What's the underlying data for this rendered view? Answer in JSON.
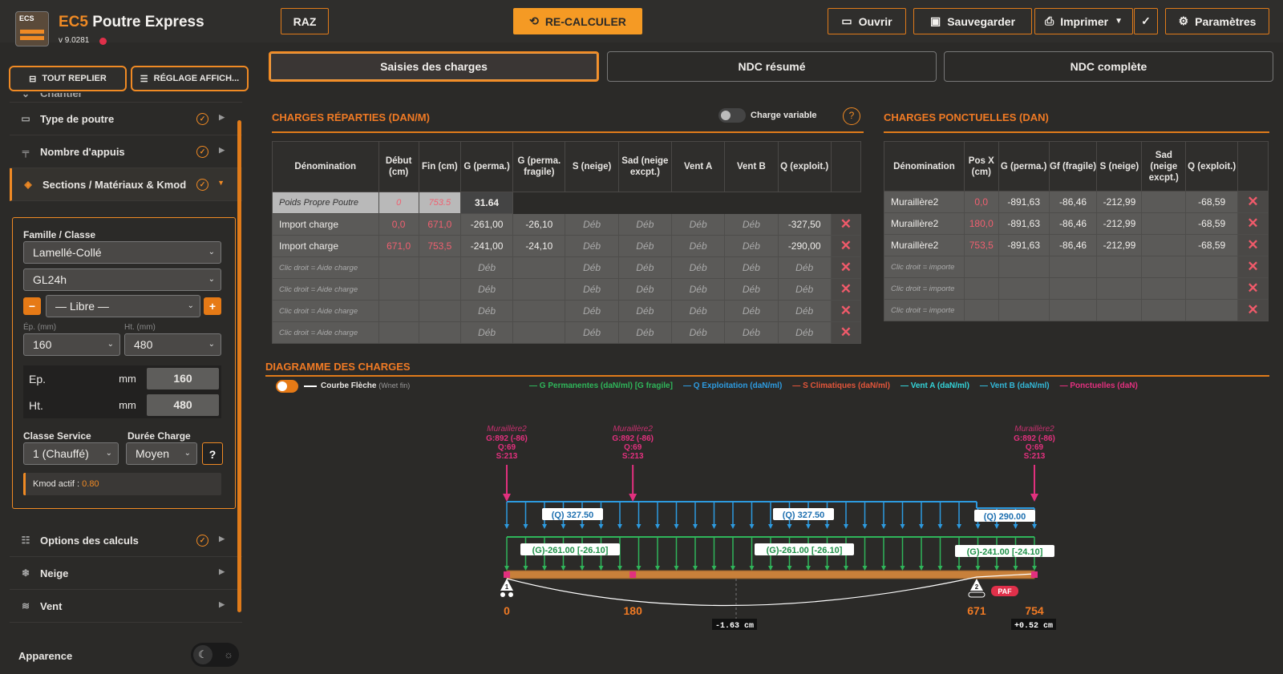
{
  "app": {
    "logo_text": "ECS",
    "title_brand": "EC5",
    "title": "Poutre Express",
    "version": "v 9.0281"
  },
  "topbar": {
    "raz": "RAZ",
    "recalc": "RE-CALCULER",
    "open": "Ouvrir",
    "save": "Sauvegarder",
    "print": "Imprimer",
    "settings": "Paramètres"
  },
  "sidebar": {
    "collapse_all": "TOUT REPLIER",
    "display_settings": "RÉGLAGE AFFICH...",
    "partial_item": "Chantier",
    "items": [
      {
        "label": "Type de poutre",
        "icon": "beam-icon"
      },
      {
        "label": "Nombre d'appuis",
        "icon": "supports-icon"
      },
      {
        "label": "Sections / Matériaux & Kmod",
        "icon": "layers-icon"
      }
    ],
    "panel": {
      "family_label": "Famille / Classe",
      "family": "Lamellé-Collé",
      "class": "GL24h",
      "free": "— Libre —",
      "ep_hint": "Ép. (mm)",
      "ht_hint": "Ht. (mm)",
      "ep_sel": "160",
      "ht_sel": "480",
      "ep_label": "Ep.",
      "ht_label": "Ht.",
      "unit": "mm",
      "ep_val": "160",
      "ht_val": "480",
      "service_label": "Classe Service",
      "duration_label": "Durée Charge",
      "service": "1 (Chauffé)",
      "duration": "Moyen",
      "help": "?",
      "kmod_label": "Kmod actif :",
      "kmod_val": "0.80"
    },
    "items2": [
      {
        "label": "Options des calculs",
        "icon": "sliders-icon"
      },
      {
        "label": "Neige",
        "icon": "snow-icon"
      },
      {
        "label": "Vent",
        "icon": "wind-icon"
      }
    ],
    "appearance": "Apparence"
  },
  "tabs": [
    "Saisies des charges",
    "NDC résumé",
    "NDC complète"
  ],
  "distributed": {
    "title": "CHARGES RÉPARTIES (DAN/M)",
    "variable": "Charge variable",
    "help": "?",
    "headers": [
      "Dénomination",
      "Début (cm)",
      "Fin (cm)",
      "G (perma.)",
      "G (perma. fragile)",
      "S (neige)",
      "Sad (neige excpt.)",
      "Vent A",
      "Vent B",
      "Q (exploit.)"
    ],
    "self_weight": {
      "name": "Poids Propre Poutre",
      "start": "0",
      "end": "753.5",
      "g": "31.64"
    },
    "rows": [
      [
        "Import charge",
        "0,0",
        "671,0",
        "-261,00",
        "-26,10",
        "Déb",
        "Déb",
        "Déb",
        "Déb",
        "-327,50"
      ],
      [
        "Import charge",
        "671,0",
        "753,5",
        "-241,00",
        "-24,10",
        "Déb",
        "Déb",
        "Déb",
        "Déb",
        "-290,00"
      ],
      [
        "Clic droit = Aide charge",
        "",
        "",
        "Déb",
        "",
        "Déb",
        "Déb",
        "Déb",
        "Déb",
        "Déb"
      ],
      [
        "Clic droit = Aide charge",
        "",
        "",
        "Déb",
        "",
        "Déb",
        "Déb",
        "Déb",
        "Déb",
        "Déb"
      ],
      [
        "Clic droit = Aide charge",
        "",
        "",
        "Déb",
        "",
        "Déb",
        "Déb",
        "Déb",
        "Déb",
        "Déb"
      ],
      [
        "Clic droit = Aide charge",
        "",
        "",
        "Déb",
        "",
        "Déb",
        "Déb",
        "Déb",
        "Déb",
        "Déb"
      ]
    ],
    "del": "✕"
  },
  "point": {
    "title": "CHARGES PONCTUELLES (DAN)",
    "headers": [
      "Dénomination",
      "Pos X (cm)",
      "G (perma.)",
      "Gf (fragile)",
      "S (neige)",
      "Sad (neige excpt.)",
      "Q (exploit.)"
    ],
    "rows": [
      [
        "Muraillère2",
        "0,0",
        "-891,63",
        "-86,46",
        "-212,99",
        "",
        "-68,59"
      ],
      [
        "Muraillère2",
        "180,0",
        "-891,63",
        "-86,46",
        "-212,99",
        "",
        "-68,59"
      ],
      [
        "Muraillère2",
        "753,5",
        "-891,63",
        "-86,46",
        "-212,99",
        "",
        "-68,59"
      ],
      [
        "Clic droit = importe",
        "",
        "",
        "",
        "",
        "",
        ""
      ],
      [
        "Clic droit = importe",
        "",
        "",
        "",
        "",
        "",
        ""
      ],
      [
        "Clic droit = importe",
        "",
        "",
        "",
        "",
        "",
        ""
      ]
    ]
  },
  "diagram": {
    "title": "DIAGRAMME DES CHARGES",
    "curve": "Courbe Flèche",
    "curve_sub": "(Wnet fin)",
    "legend": [
      {
        "label": "G Permanentes (daN/ml) [G fragile]",
        "color": "#2fb55a"
      },
      {
        "label": "Q Exploitation (daN/ml)",
        "color": "#2d9be0"
      },
      {
        "label": "S Climatiques (daN/ml)",
        "color": "#e2553a"
      },
      {
        "label": "Vent A (daN/ml)",
        "color": "#33d3d8"
      },
      {
        "label": "Vent B (daN/ml)",
        "color": "#33b8d8"
      },
      {
        "label": "Ponctuelles (daN)",
        "color": "#e2307e"
      }
    ],
    "point_labels": [
      {
        "pos": 0,
        "name": "Muraillère2",
        "g": "G:892 (-86)",
        "q": "Q:69",
        "s": "S:213"
      },
      {
        "pos": 180,
        "name": "Muraillère2",
        "g": "G:892 (-86)",
        "q": "Q:69",
        "s": "S:213"
      },
      {
        "pos": 753.5,
        "name": "Muraillère2",
        "g": "G:892 (-86)",
        "q": "Q:69",
        "s": "S:213"
      }
    ],
    "q_labels": [
      "(Q) 327.50",
      "(Q) 327.50",
      "(Q) 290.00"
    ],
    "g_labels": [
      "(G)-261.00 [-26.10]",
      "(G)-261.00 [-26.10]",
      "(G)-241.00 [-24.10]"
    ],
    "positions": [
      "0",
      "180",
      "671",
      "754"
    ],
    "deflection1": "-1.63 cm",
    "deflection2": "+0.52 cm",
    "paf": "PAF",
    "support1": "1",
    "support2": "2"
  },
  "colors": {
    "accent": "#f08a24",
    "g": "#2fb55a",
    "q": "#2d9be0",
    "point": "#e2307e"
  }
}
